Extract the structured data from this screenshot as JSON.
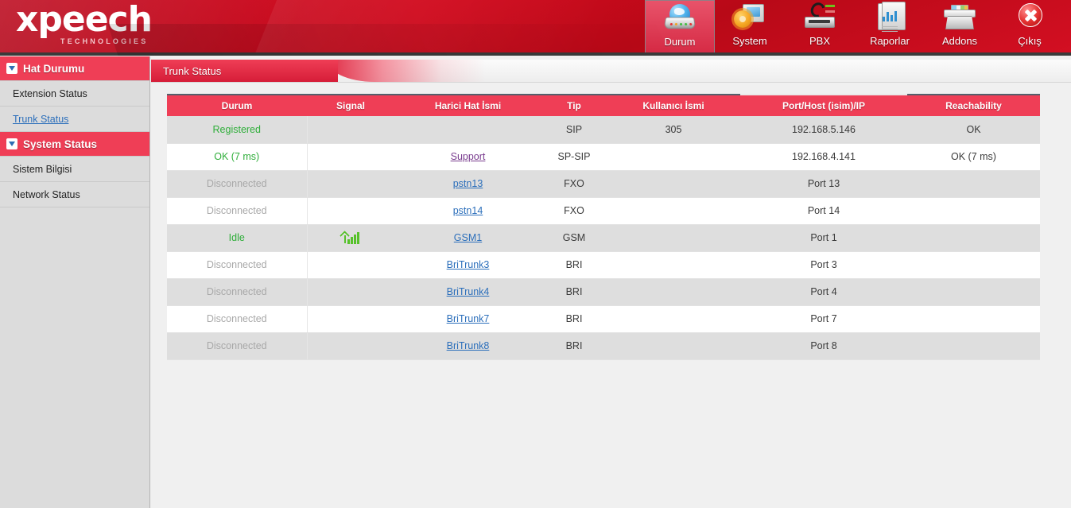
{
  "brand": {
    "name": "xpeech",
    "tagline": "TECHNOLOGIES",
    "logo_icon": "xpeech-logo"
  },
  "nav": {
    "items": [
      {
        "label": "Durum",
        "icon": "status-modem-icon",
        "active": true
      },
      {
        "label": "System",
        "icon": "system-gear-icon",
        "active": false
      },
      {
        "label": "PBX",
        "icon": "pbx-phone-icon",
        "active": false
      },
      {
        "label": "Raporlar",
        "icon": "reports-chart-icon",
        "active": false
      },
      {
        "label": "Addons",
        "icon": "addons-box-icon",
        "active": false
      },
      {
        "label": "Çıkış",
        "icon": "exit-close-icon",
        "active": false
      }
    ]
  },
  "sidebar": {
    "sections": [
      {
        "title": "Hat Durumu",
        "toggle_icon": "chevron-down-icon",
        "items": [
          {
            "label": "Extension Status",
            "active": false
          },
          {
            "label": "Trunk Status",
            "active": true
          }
        ]
      },
      {
        "title": "System Status",
        "toggle_icon": "chevron-down-icon",
        "items": [
          {
            "label": "Sistem Bilgisi",
            "active": false
          },
          {
            "label": "Network Status",
            "active": false
          }
        ]
      }
    ]
  },
  "content": {
    "tab": {
      "label": "Trunk Status"
    },
    "table": {
      "columns": [
        "Durum",
        "Signal",
        "Harici Hat İsmi",
        "Tip",
        "Kullanıcı İsmi",
        "Port/Host (isim)/IP",
        "Reachability"
      ],
      "rows": [
        {
          "durum": "Registered",
          "durum_state": "ok",
          "signal": "",
          "trunk": "",
          "trunk_link": false,
          "trunk_visited": false,
          "tip": "SIP",
          "user": "305",
          "host": "192.168.5.146",
          "reach": "OK"
        },
        {
          "durum": "OK (7 ms)",
          "durum_state": "ok",
          "signal": "",
          "trunk": "Support",
          "trunk_link": true,
          "trunk_visited": true,
          "tip": "SP-SIP",
          "user": "",
          "host": "192.168.4.141",
          "reach": "OK (7 ms)"
        },
        {
          "durum": "Disconnected",
          "durum_state": "off",
          "signal": "",
          "trunk": "pstn13",
          "trunk_link": true,
          "trunk_visited": false,
          "tip": "FXO",
          "user": "",
          "host": "Port 13",
          "reach": ""
        },
        {
          "durum": "Disconnected",
          "durum_state": "off",
          "signal": "",
          "trunk": "pstn14",
          "trunk_link": true,
          "trunk_visited": false,
          "tip": "FXO",
          "user": "",
          "host": "Port 14",
          "reach": ""
        },
        {
          "durum": "Idle",
          "durum_state": "ok",
          "signal": "signal-bars-icon",
          "trunk": "GSM1",
          "trunk_link": true,
          "trunk_visited": false,
          "tip": "GSM",
          "user": "",
          "host": "Port 1",
          "reach": ""
        },
        {
          "durum": "Disconnected",
          "durum_state": "off",
          "signal": "",
          "trunk": "BriTrunk3",
          "trunk_link": true,
          "trunk_visited": false,
          "tip": "BRI",
          "user": "",
          "host": "Port 3",
          "reach": ""
        },
        {
          "durum": "Disconnected",
          "durum_state": "off",
          "signal": "",
          "trunk": "BriTrunk4",
          "trunk_link": true,
          "trunk_visited": false,
          "tip": "BRI",
          "user": "",
          "host": "Port 4",
          "reach": ""
        },
        {
          "durum": "Disconnected",
          "durum_state": "off",
          "signal": "",
          "trunk": "BriTrunk7",
          "trunk_link": true,
          "trunk_visited": false,
          "tip": "BRI",
          "user": "",
          "host": "Port 7",
          "reach": ""
        },
        {
          "durum": "Disconnected",
          "durum_state": "off",
          "signal": "",
          "trunk": "BriTrunk8",
          "trunk_link": true,
          "trunk_visited": false,
          "tip": "BRI",
          "user": "",
          "host": "Port 8",
          "reach": ""
        }
      ]
    }
  },
  "colors": {
    "brand_red": "#cf0a1d",
    "accent_red": "#ef3e56",
    "status_ok": "#2fae3a",
    "status_off": "#a8a8a8",
    "link_blue": "#2c6fbb",
    "link_visited": "#7a3d8f",
    "sidebar_bg": "#dcdcdc",
    "row_alt_bg": "#dedede"
  }
}
